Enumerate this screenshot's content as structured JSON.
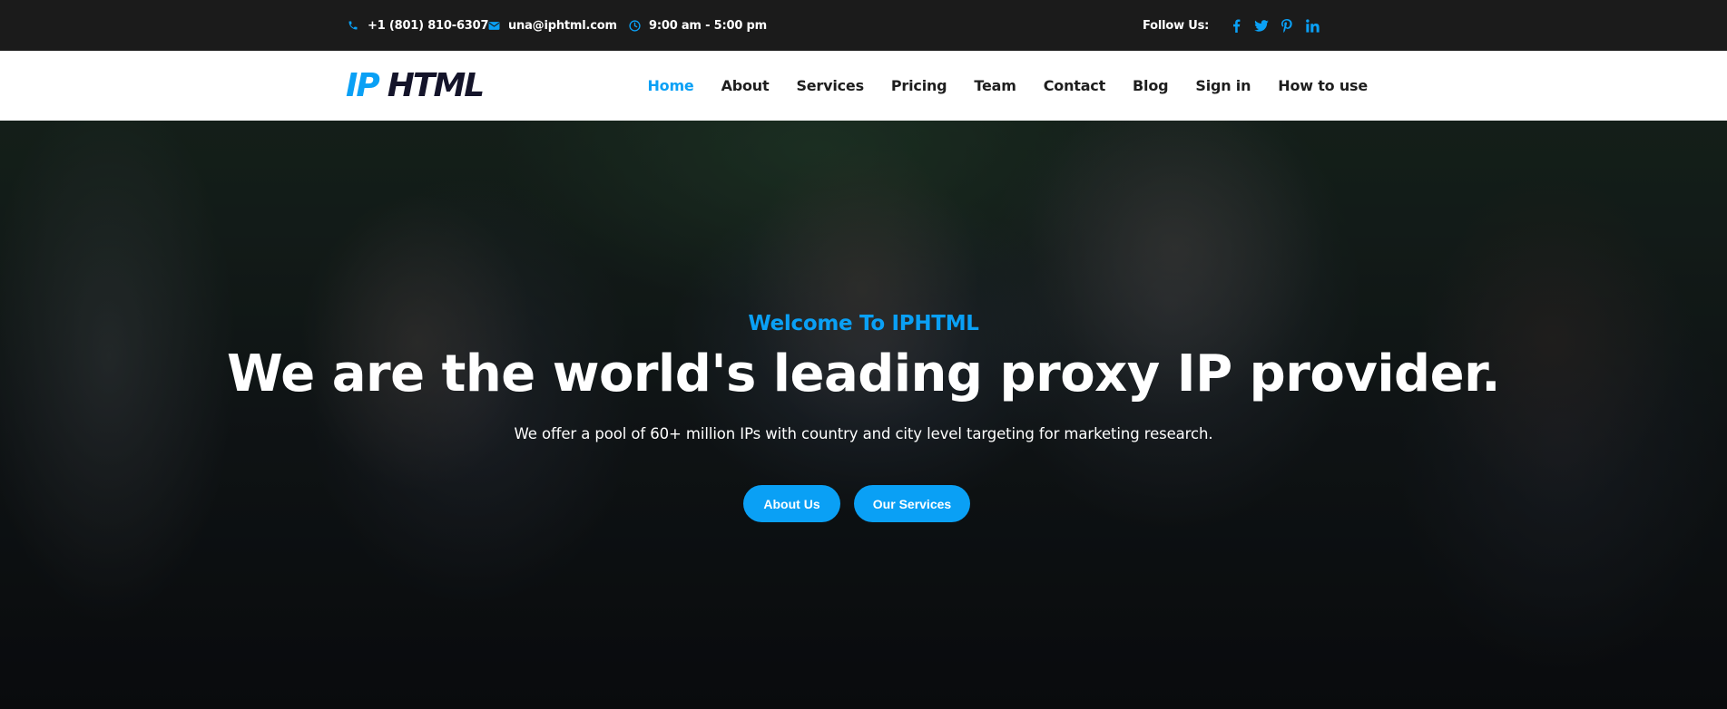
{
  "topbar": {
    "phone": "+1 (801) 810-6307",
    "email": "una@iphtml.com",
    "hours": "9:00 am - 5:00 pm",
    "follow_label": "Follow Us:",
    "icons": [
      "phone-icon",
      "email-icon",
      "clock-icon",
      "facebook-icon",
      "twitter-icon",
      "pinterest-icon",
      "linkedin-icon"
    ]
  },
  "brand": {
    "logo_ip": "IP",
    "logo_html": "HTML"
  },
  "nav": {
    "items": [
      {
        "label": "Home",
        "active": true
      },
      {
        "label": "About"
      },
      {
        "label": "Services"
      },
      {
        "label": "Pricing"
      },
      {
        "label": "Team"
      },
      {
        "label": "Contact"
      },
      {
        "label": "Blog"
      },
      {
        "label": "Sign in"
      },
      {
        "label": "How to use"
      }
    ]
  },
  "hero": {
    "welcome": "Welcome To IPHTML",
    "headline": "We are the world's leading proxy IP provider.",
    "subline": "We offer a pool of 60+ million IPs with country and city level targeting for marketing research.",
    "about_button": "About Us",
    "services_button": "Our Services"
  },
  "colors": {
    "accent": "#0aa0f5",
    "topbar_bg": "#1b1b1b",
    "nav_bg": "#ffffff",
    "nav_text": "#1e1e1e"
  }
}
